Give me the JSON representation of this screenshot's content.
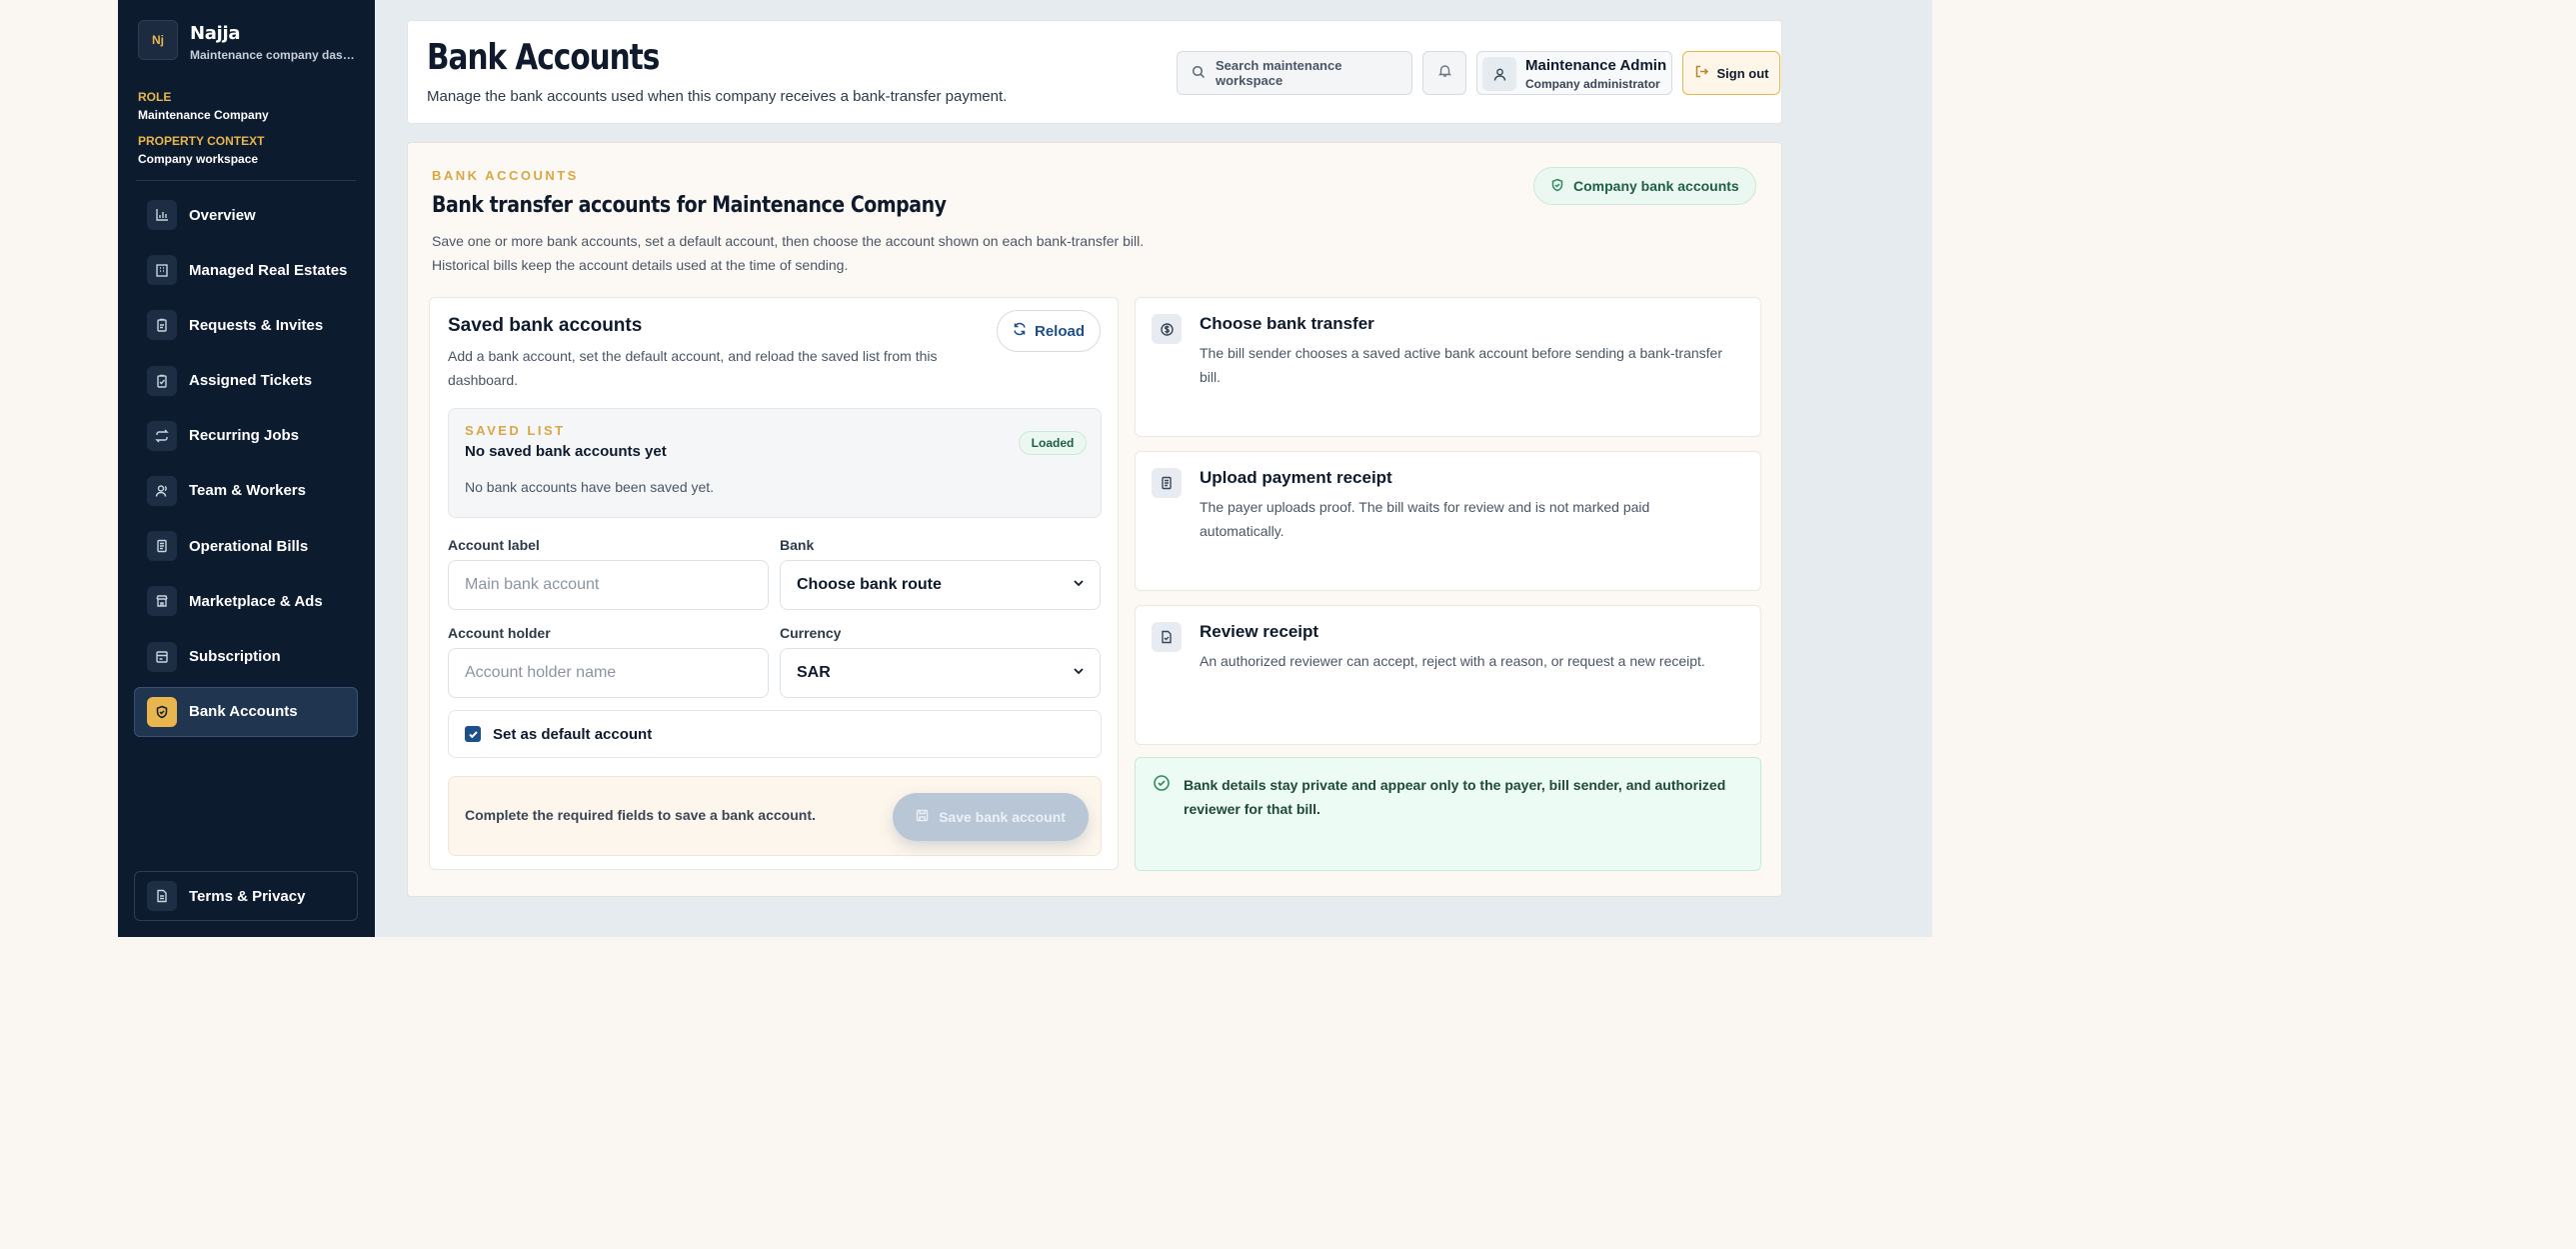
{
  "brand": {
    "logo_text": "Nj",
    "name": "Najja",
    "subtitle": "Maintenance company dashboard"
  },
  "context": {
    "role_label": "ROLE",
    "role_value": "Maintenance Company",
    "property_label": "PROPERTY CONTEXT",
    "property_value": "Company workspace"
  },
  "sidebar": {
    "items": [
      {
        "label": "Overview",
        "icon": "chart-icon"
      },
      {
        "label": "Managed Real Estates",
        "icon": "building-icon"
      },
      {
        "label": "Requests & Invites",
        "icon": "clipboard-icon"
      },
      {
        "label": "Assigned Tickets",
        "icon": "clipboard-check-icon"
      },
      {
        "label": "Recurring Jobs",
        "icon": "repeat-icon"
      },
      {
        "label": "Team & Workers",
        "icon": "users-icon"
      },
      {
        "label": "Operational Bills",
        "icon": "receipt-icon"
      },
      {
        "label": "Marketplace & Ads",
        "icon": "store-icon"
      },
      {
        "label": "Subscription",
        "icon": "card-icon"
      },
      {
        "label": "Bank Accounts",
        "icon": "shield-icon",
        "active": true
      }
    ],
    "terms_label": "Terms & Privacy"
  },
  "header": {
    "title": "Bank Accounts",
    "subtitle": "Manage the bank accounts used when this company receives a bank-transfer payment.",
    "search_placeholder": "Search maintenance workspace",
    "user_name": "Maintenance Admin",
    "user_role": "Company administrator",
    "signout_label": "Sign out"
  },
  "main": {
    "eyebrow": "BANK ACCOUNTS",
    "title": "Bank transfer accounts for Maintenance Company",
    "desc_line1": "Save one or more bank accounts, set a default account, then choose the account shown on each bank-transfer bill.",
    "desc_line2": "Historical bills keep the account details used at the time of sending.",
    "badge": "Company bank accounts",
    "saved": {
      "title": "Saved bank accounts",
      "desc": "Add a bank account, set the default account, and reload the saved list from this dashboard.",
      "reload_label": "Reload",
      "list_eyebrow": "SAVED LIST",
      "list_title": "No saved bank accounts yet",
      "list_status": "Loaded",
      "list_empty": "No bank accounts have been saved yet."
    },
    "form": {
      "account_label_label": "Account label",
      "account_label_placeholder": "Main bank account",
      "bank_label": "Bank",
      "bank_value": "Choose bank route",
      "holder_label": "Account holder",
      "holder_placeholder": "Account holder name",
      "currency_label": "Currency",
      "currency_value": "SAR",
      "default_label": "Set as default account",
      "default_checked": true,
      "save_hint": "Complete the required fields to save a bank account.",
      "save_label": "Save bank account"
    },
    "steps": [
      {
        "title": "Choose bank transfer",
        "desc": "The bill sender chooses a saved active bank account before sending a bank-transfer bill."
      },
      {
        "title": "Upload payment receipt",
        "desc": "The payer uploads proof. The bill waits for review and is not marked paid automatically."
      },
      {
        "title": "Review receipt",
        "desc": "An authorized reviewer can accept, reject with a reason, or request a new receipt."
      }
    ],
    "privacy_note": "Bank details stay private and appear only to the payer, bill sender, and authorized reviewer for that bill."
  },
  "colors": {
    "sidebar": "#0d1b2e",
    "accent_gold": "#e8b64d",
    "link_blue": "#1d4f8a",
    "success_green": "#2f8a5f"
  }
}
